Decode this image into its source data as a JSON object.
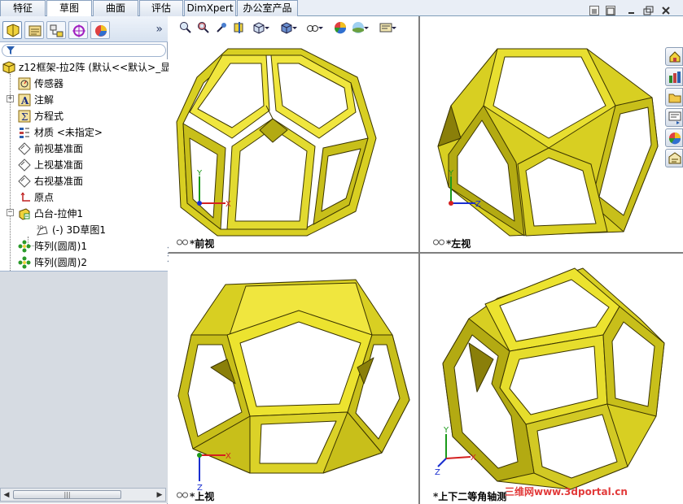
{
  "command_tabs": [
    "特征",
    "草图",
    "曲面",
    "评估",
    "DimXpert",
    "办公室产品"
  ],
  "active_tab": "草图",
  "feature_manager": {
    "tabs": [
      "feature-manager-tab",
      "property-manager-tab",
      "configuration-manager-tab",
      "dimxpert-manager-tab",
      "display-manager-tab"
    ],
    "more_label": "»",
    "root": "z12框架-拉2阵 (默认<<默认>_显",
    "items": [
      {
        "label": "传感器",
        "icon": "sensor-icon"
      },
      {
        "label": "注解",
        "icon": "annotation-icon"
      },
      {
        "label": "方程式",
        "icon": "equation-icon"
      },
      {
        "label": "材质 <未指定>",
        "icon": "material-icon"
      },
      {
        "label": "前视基准面",
        "icon": "plane-icon"
      },
      {
        "label": "上视基准面",
        "icon": "plane-icon"
      },
      {
        "label": "右视基准面",
        "icon": "plane-icon"
      },
      {
        "label": "原点",
        "icon": "origin-icon"
      },
      {
        "label": "凸台-拉伸1",
        "icon": "extrude-icon"
      },
      {
        "label": "(-) 3D草图1",
        "icon": "sketch3d-icon"
      },
      {
        "label": "阵列(圆周)1",
        "icon": "circular-pattern-icon"
      },
      {
        "label": "阵列(圆周)2",
        "icon": "circular-pattern-icon"
      }
    ],
    "scrollbar_grip": "|||"
  },
  "viewports": [
    {
      "id": "front",
      "label": "*前视",
      "axes": [
        "Y",
        "X"
      ]
    },
    {
      "id": "left",
      "label": "*左视",
      "axes": [
        "Y",
        "Z"
      ]
    },
    {
      "id": "top",
      "label": "*上视",
      "axes": [
        "X",
        "Z"
      ]
    },
    {
      "id": "dimetric",
      "label": "*上下二等角轴测",
      "axes": [
        "Y",
        "X",
        "Z"
      ]
    }
  ],
  "watermark": "三维网www.3dportal.cn",
  "colors": {
    "frame_light": "#e8e23a",
    "frame_mid": "#c8bf1a",
    "frame_dark": "#8a7f0a",
    "frame_edge": "#3a3400",
    "axis_x": "#d42020",
    "axis_y": "#1a9a1a",
    "axis_z": "#1a2fd0"
  }
}
